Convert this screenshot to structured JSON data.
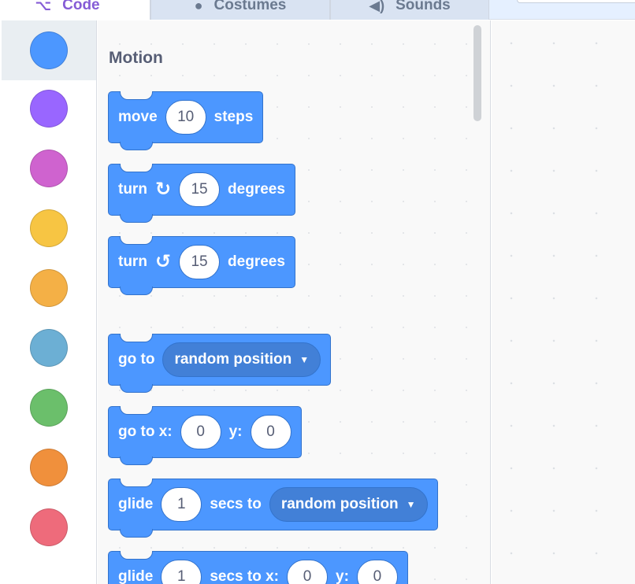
{
  "tabs": [
    {
      "label": "Code",
      "icon": "code-icon"
    },
    {
      "label": "Costumes",
      "icon": "brush-icon"
    },
    {
      "label": "Sounds",
      "icon": "speaker-icon"
    }
  ],
  "categories": [
    {
      "name": "motion",
      "color": "#4c97ff"
    },
    {
      "name": "looks",
      "color": "#9966ff"
    },
    {
      "name": "sound",
      "color": "#cf63cf"
    },
    {
      "name": "events",
      "color": "#ffbf00"
    },
    {
      "name": "control",
      "color": "#ffab19"
    },
    {
      "name": "sensing",
      "color": "#5cb1d6"
    },
    {
      "name": "operators",
      "color": "#59c059"
    },
    {
      "name": "variables",
      "color": "#ff8c1a"
    },
    {
      "name": "my-blocks",
      "color": "#ff6680"
    }
  ],
  "palette": {
    "section_title": "Motion",
    "blocks": {
      "move": {
        "label": "move",
        "value": "10",
        "suffix": "steps"
      },
      "turn_right": {
        "label": "turn",
        "icon": "↻",
        "value": "15",
        "suffix": "degrees"
      },
      "turn_left": {
        "label": "turn",
        "icon": "↺",
        "value": "15",
        "suffix": "degrees"
      },
      "goto": {
        "label": "go to",
        "dropdown": "random position"
      },
      "goto_xy": {
        "label": "go to x:",
        "x": "0",
        "ylabel": "y:",
        "y": "0"
      },
      "glide": {
        "label": "glide",
        "secs": "1",
        "mid": "secs to",
        "dropdown": "random position"
      },
      "glide_xy": {
        "label": "glide",
        "secs": "1",
        "mid": "secs to x:",
        "x": "0",
        "ylabel": "y:",
        "y": "0"
      }
    }
  },
  "colors": {
    "motion_block": "#4c97ff",
    "motion_border": "#3373cc",
    "active_tab": "#855cd6"
  }
}
